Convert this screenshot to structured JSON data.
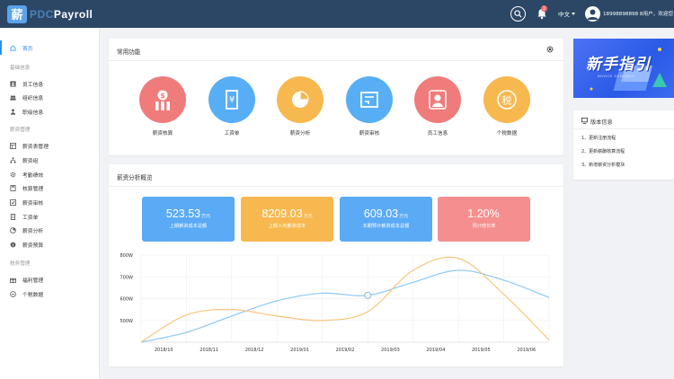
{
  "header": {
    "logo_mark": "薪",
    "logo_text_dim": "PDC",
    "logo_text": "Payroll",
    "notification_count": "2",
    "language": "中文",
    "user": "18998898898 8用户，欢迎您"
  },
  "sidebar": {
    "home": "首页",
    "groups": [
      {
        "title": "基础信息",
        "items": [
          "员工信息",
          "组织信息",
          "职级信息"
        ]
      },
      {
        "title": "薪资管理",
        "items": [
          "薪资表管理",
          "薪资组",
          "考勤绩效",
          "核算管理",
          "薪资审核",
          "工资单",
          "薪资分析",
          "薪资预算"
        ]
      },
      {
        "title": "税务管理",
        "items": [
          "福利管理",
          "个税数据"
        ]
      }
    ]
  },
  "functions": {
    "title": "常用功能",
    "items": [
      {
        "label": "薪资核算",
        "icon": "payroll-calc-icon",
        "color": "#f07b7b"
      },
      {
        "label": "工资单",
        "icon": "payslip-icon",
        "color": "#58aef5"
      },
      {
        "label": "薪资分析",
        "icon": "pie-chart-icon",
        "color": "#f7b84f"
      },
      {
        "label": "薪资审核",
        "icon": "review-icon",
        "color": "#58aef5"
      },
      {
        "label": "员工信息",
        "icon": "employee-icon",
        "color": "#f07b7b"
      },
      {
        "label": "个税数据",
        "icon": "tax-icon",
        "color": "#f7b84f"
      }
    ],
    "tax_glyph": "税"
  },
  "overview": {
    "title": "薪资分析概览",
    "stats": [
      {
        "value": "523.53",
        "unit": "万元",
        "label": "上期薪资成本总额",
        "color": "#5aaaf5"
      },
      {
        "value": "8209.03",
        "unit": "万元",
        "label": "上期人均薪资成本",
        "color": "#f7b84f"
      },
      {
        "value": "609.03",
        "unit": "万元",
        "label": "本期预计薪资成本总额",
        "color": "#5aaaf5"
      },
      {
        "value": "1.20%",
        "unit": "",
        "label": "预计增长率",
        "color": "#f58e8e"
      }
    ]
  },
  "chart_data": {
    "type": "line",
    "title": "",
    "xlabel": "",
    "ylabel": "",
    "categories": [
      "2018/10",
      "2018/11",
      "2018/12",
      "2019/01",
      "2019/02",
      "2019/03",
      "2019/04",
      "2019/05",
      "2019/06"
    ],
    "y_ticks": [
      "800W",
      "700W",
      "600W",
      "500W"
    ],
    "ylim": [
      400,
      800
    ],
    "grid": true,
    "series": [
      {
        "color": "#8cc8f5",
        "values": [
          400,
          445,
          520,
          590,
          625,
          615,
          675,
          730,
          685,
          605
        ]
      },
      {
        "color": "#f7c57e",
        "values": [
          400,
          525,
          550,
          520,
          500,
          540,
          730,
          785,
          620,
          410
        ]
      }
    ]
  },
  "banner": {
    "title": "新手指引",
    "subtitle": "NOVICE GUIDANCE"
  },
  "version": {
    "title": "版本信息",
    "items": [
      "1、更新注册流程",
      "2、更新薪酬核算流程",
      "3、新增薪资分析模块"
    ]
  }
}
